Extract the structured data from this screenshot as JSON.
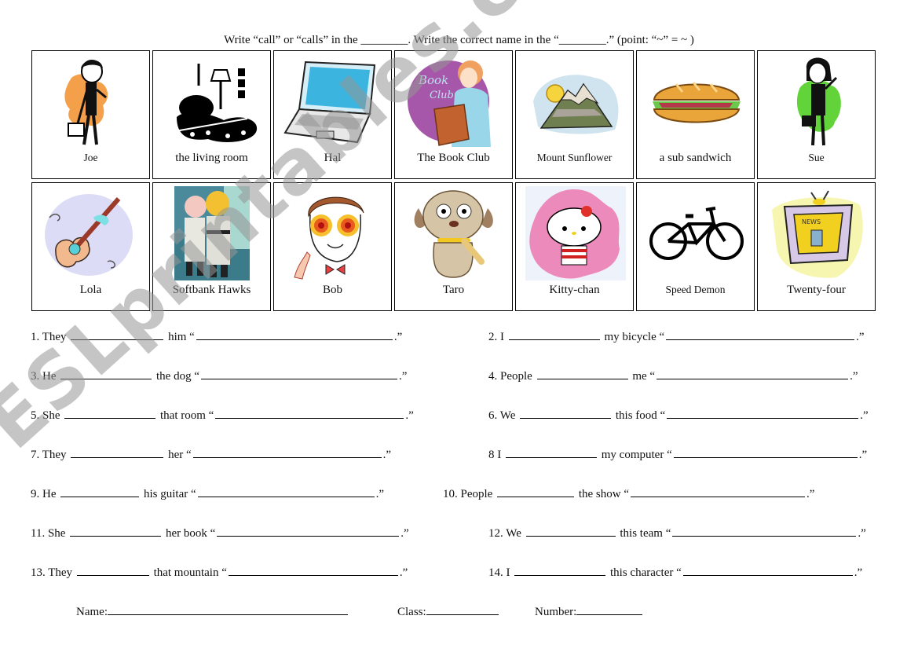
{
  "instructions": "Write “call” or “calls” in the ________. Write the correct name in the “________.” (point: “~” =   ~   )",
  "cards_row1": [
    {
      "label": "Joe",
      "icon": "businessman-icon"
    },
    {
      "label": "the living room",
      "icon": "armchair-lamp-icon"
    },
    {
      "label": "Hal",
      "icon": "laptop-icon"
    },
    {
      "label": "The Book Club",
      "icon": "woman-reading-book-icon",
      "badge_text": "The Book Club"
    },
    {
      "label": "Mount Sunflower",
      "icon": "mountain-sun-icon"
    },
    {
      "label": "a sub sandwich",
      "icon": "sub-sandwich-icon"
    },
    {
      "label": "Sue",
      "icon": "businesswoman-icon"
    }
  ],
  "cards_row2": [
    {
      "label": "Lola",
      "icon": "guitar-icon"
    },
    {
      "label": "Softbank Hawks",
      "icon": "baseball-mascots-photo"
    },
    {
      "label": "Bob",
      "icon": "boy-with-glasses-icon"
    },
    {
      "label": "Taro",
      "icon": "dog-with-bone-icon"
    },
    {
      "label": "Kitty-chan",
      "icon": "hello-kitty-icon"
    },
    {
      "label": "Speed Demon",
      "icon": "bicycle-icon"
    },
    {
      "label": "Twenty-four",
      "icon": "television-icon",
      "screen_text": "NEWS"
    }
  ],
  "questions": [
    {
      "num": "1.",
      "subject": "They",
      "object": "him"
    },
    {
      "num": "2.",
      "subject": "I",
      "object": "my bicycle"
    },
    {
      "num": "3.",
      "subject": "He",
      "object": "the dog"
    },
    {
      "num": "4.",
      "subject": "People",
      "object": "me"
    },
    {
      "num": "5.",
      "subject": "She",
      "object": "that room"
    },
    {
      "num": "6.",
      "subject": "We",
      "object": "this food"
    },
    {
      "num": "7.",
      "subject": "They",
      "object": "her"
    },
    {
      "num": "8",
      "subject": "I",
      "object": "my computer"
    },
    {
      "num": "9.",
      "subject": "He",
      "object": "his guitar"
    },
    {
      "num": "10.",
      "subject": "People",
      "object": "the show"
    },
    {
      "num": "11.",
      "subject": "She",
      "object": "her book"
    },
    {
      "num": "12.",
      "subject": "We",
      "object": "this team"
    },
    {
      "num": "13.",
      "subject": "They",
      "object": "that mountain"
    },
    {
      "num": "14.",
      "subject": "I",
      "object": "this character"
    }
  ],
  "quote_open": "“",
  "quote_close": ".”",
  "footer": {
    "name_label": "Name:",
    "class_label": "Class:",
    "number_label": "Number:"
  },
  "watermark": "ESLprintables.com"
}
